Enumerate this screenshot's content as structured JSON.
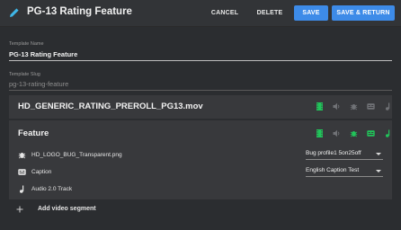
{
  "header": {
    "title": "PG-13 Rating Feature",
    "cancel_label": "CANCEL",
    "delete_label": "DELETE",
    "save_label": "SAVE",
    "save_return_label": "SAVE & RETURN"
  },
  "form": {
    "name_label": "Template Name",
    "name_value": "PG-13 Rating Feature",
    "slug_label": "Template Slug",
    "slug_value": "pg-13-rating-feature"
  },
  "segments": [
    {
      "title": "HD_GENERIC_RATING_PREROLL_PG13.mov",
      "toolbar_icons": [
        "film-icon",
        "volume-icon",
        "bug-icon",
        "caption-icon",
        "music-note-icon"
      ]
    },
    {
      "title": "Feature",
      "toolbar_icons": [
        "film-icon",
        "volume-icon",
        "bug-icon",
        "caption-icon",
        "music-note-icon"
      ],
      "rows": [
        {
          "icon": "bug-icon",
          "label": "HD_LOGO_BUG_Transparent.png",
          "select_value": "Bug profile1 5on25off"
        },
        {
          "icon": "caption-icon",
          "label": "Caption",
          "select_value": "English Caption Test"
        },
        {
          "icon": "music-note-icon",
          "label": "Audio 2.0 Track"
        }
      ]
    }
  ],
  "add_segment": {
    "label": "Add video segment",
    "icon": "plus-icon"
  },
  "colors": {
    "background": "#2b2d30",
    "panel": "#38393c",
    "accent": "#3d8be8",
    "active_icon": "#21c45a",
    "inactive_icon": "#707276"
  }
}
